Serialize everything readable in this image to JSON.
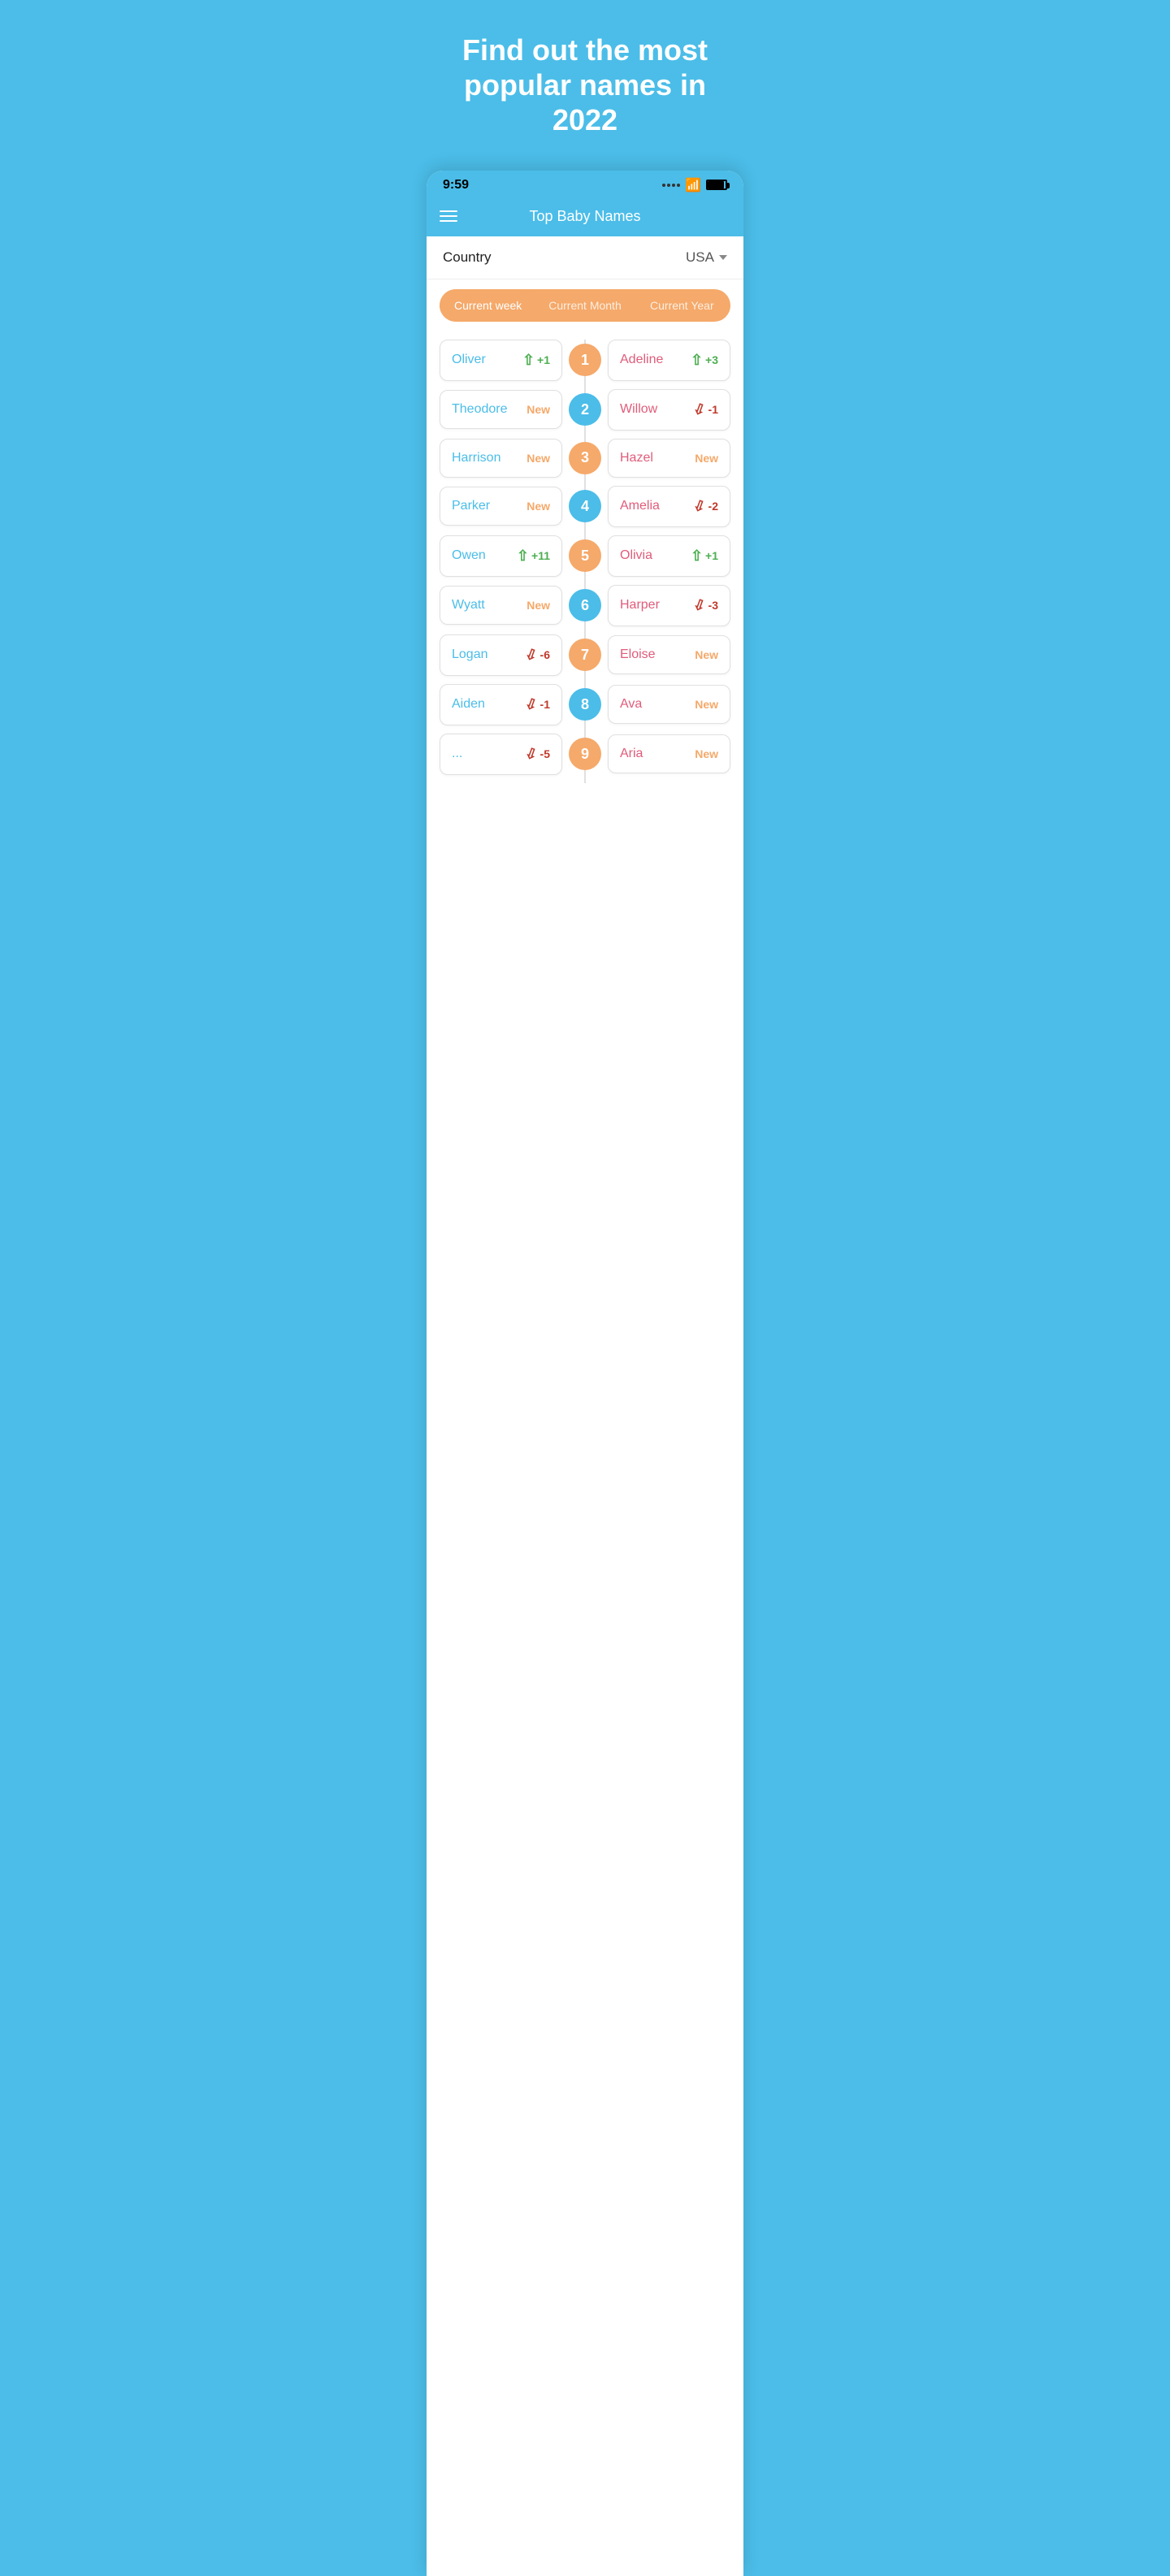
{
  "hero": {
    "title": "Find out the most popular names in 2022"
  },
  "statusBar": {
    "time": "9:59"
  },
  "header": {
    "title": "Top Baby Names"
  },
  "countrySelector": {
    "label": "Country",
    "value": "USA"
  },
  "periodTabs": [
    {
      "id": "week",
      "label": "Current week",
      "active": true
    },
    {
      "id": "month",
      "label": "Current Month",
      "active": false
    },
    {
      "id": "year",
      "label": "Current Year",
      "active": false
    }
  ],
  "nameRows": [
    {
      "rank": "1",
      "rankStyle": "orange",
      "boy": {
        "name": "Oliver",
        "changeType": "up",
        "changeValue": "+1"
      },
      "girl": {
        "name": "Adeline",
        "changeType": "up",
        "changeValue": "+3"
      }
    },
    {
      "rank": "2",
      "rankStyle": "blue",
      "boy": {
        "name": "Theodore",
        "changeType": "new",
        "changeValue": "New"
      },
      "girl": {
        "name": "Willow",
        "changeType": "down",
        "changeValue": "-1"
      }
    },
    {
      "rank": "3",
      "rankStyle": "orange",
      "boy": {
        "name": "Harrison",
        "changeType": "new",
        "changeValue": "New"
      },
      "girl": {
        "name": "Hazel",
        "changeType": "new",
        "changeValue": "New"
      }
    },
    {
      "rank": "4",
      "rankStyle": "blue",
      "boy": {
        "name": "Parker",
        "changeType": "new",
        "changeValue": "New"
      },
      "girl": {
        "name": "Amelia",
        "changeType": "down",
        "changeValue": "-2"
      }
    },
    {
      "rank": "5",
      "rankStyle": "orange",
      "boy": {
        "name": "Owen",
        "changeType": "up",
        "changeValue": "+11"
      },
      "girl": {
        "name": "Olivia",
        "changeType": "up",
        "changeValue": "+1"
      }
    },
    {
      "rank": "6",
      "rankStyle": "blue",
      "boy": {
        "name": "Wyatt",
        "changeType": "new",
        "changeValue": "New"
      },
      "girl": {
        "name": "Harper",
        "changeType": "down",
        "changeValue": "-3"
      }
    },
    {
      "rank": "7",
      "rankStyle": "orange",
      "boy": {
        "name": "Logan",
        "changeType": "down",
        "changeValue": "-6"
      },
      "girl": {
        "name": "Eloise",
        "changeType": "new",
        "changeValue": "New"
      }
    },
    {
      "rank": "8",
      "rankStyle": "blue",
      "boy": {
        "name": "Aiden",
        "changeType": "down",
        "changeValue": "-1"
      },
      "girl": {
        "name": "Ava",
        "changeType": "new",
        "changeValue": "New"
      }
    },
    {
      "rank": "9",
      "rankStyle": "orange",
      "boy": {
        "name": "...",
        "changeType": "down",
        "changeValue": "-5"
      },
      "girl": {
        "name": "Aria",
        "changeType": "new",
        "changeValue": "New"
      }
    }
  ]
}
